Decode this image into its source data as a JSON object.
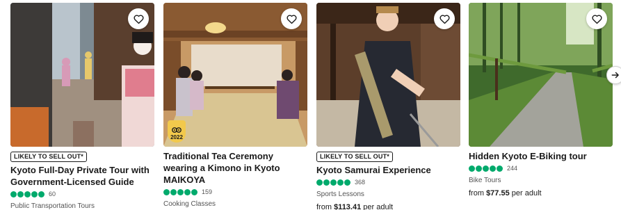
{
  "cards": [
    {
      "tag": "LIKELY TO SELL OUT*",
      "title": "Kyoto Full-Day Private Tour with Government-Licensed Guide",
      "reviews": "60",
      "rating_bubbles": 5,
      "category": "Public Transportation Tours",
      "price_prefix": "",
      "price": "",
      "price_suffix": ""
    },
    {
      "tag": "",
      "title": "Traditional Tea Ceremony wearing a Kimono in Kyoto MAIKOYA",
      "reviews": "159",
      "rating_bubbles": 5,
      "category": "Cooking Classes",
      "award_year": "2022",
      "price_prefix": "",
      "price": "",
      "price_suffix": ""
    },
    {
      "tag": "LIKELY TO SELL OUT*",
      "title": "Kyoto Samurai Experience",
      "reviews": "368",
      "rating_bubbles": 5,
      "category": "Sports Lessons",
      "price_prefix": "from ",
      "price": "$113.41",
      "price_suffix": " per adult"
    },
    {
      "tag": "",
      "title": "Hidden Kyoto E-Biking tour",
      "reviews": "244",
      "rating_bubbles": 5,
      "category": "Bike Tours",
      "price_prefix": "from ",
      "price": "$77.55",
      "price_suffix": " per adult"
    }
  ],
  "icons": {
    "favorite": "heart-outline-icon",
    "next": "arrow-right-icon",
    "award": "travelers-choice-badge-icon"
  },
  "colors": {
    "rating_green": "#00aa6c",
    "award_yellow": "#f2c94c",
    "text": "#1a1a1a",
    "muted": "#545454"
  }
}
